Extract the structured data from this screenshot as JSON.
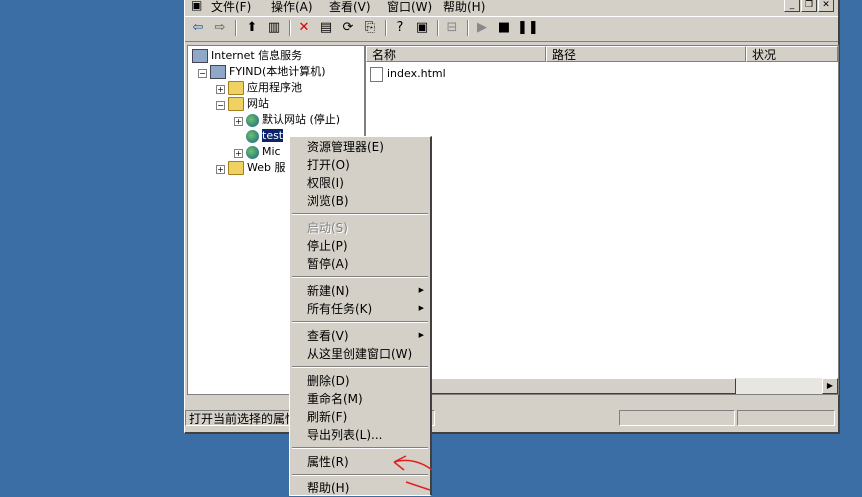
{
  "menubar": {
    "file": "文件(F)",
    "action": "操作(A)",
    "view": "查看(V)",
    "window": "窗口(W)",
    "help": "帮助(H)"
  },
  "window_buttons": {
    "minimize": "_",
    "restore": "❐",
    "close": "✕"
  },
  "tree": {
    "root": "Internet 信息服务",
    "computer": "FYIND(本地计算机)",
    "app_pools": "应用程序池",
    "websites": "网站",
    "default_site": "默认网站 (停止)",
    "test_site": "test",
    "ms_site": "Mic",
    "web_ext": "Web 服"
  },
  "list": {
    "col_name": "名称",
    "col_path": "路径",
    "col_status": "状况",
    "items": [
      "index.html"
    ]
  },
  "statusbar": {
    "text": "打开当前选择的属性"
  },
  "context_menu": {
    "explorer": "资源管理器(E)",
    "open": "打开(O)",
    "permissions": "权限(I)",
    "browse": "浏览(B)",
    "start": "启动(S)",
    "stop": "停止(P)",
    "pause": "暂停(A)",
    "new": "新建(N)",
    "all_tasks": "所有任务(K)",
    "view": "查看(V)",
    "new_window": "从这里创建窗口(W)",
    "delete": "删除(D)",
    "rename": "重命名(M)",
    "refresh": "刷新(F)",
    "export": "导出列表(L)...",
    "properties": "属性(R)",
    "help": "帮助(H)"
  },
  "colors": {
    "desktop": "#3a6ea5",
    "selection": "#0a246a",
    "annotation": "#e02020"
  }
}
